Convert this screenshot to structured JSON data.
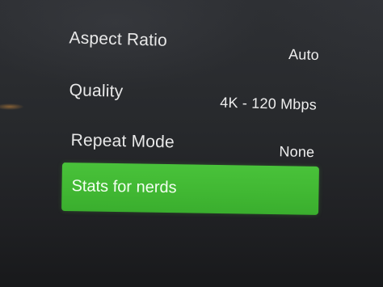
{
  "menu": {
    "items": [
      {
        "label": "Aspect Ratio",
        "value": "Auto"
      },
      {
        "label": "Quality",
        "value": "4K - 120 Mbps"
      },
      {
        "label": "Repeat Mode",
        "value": "None"
      },
      {
        "label": "Stats for nerds",
        "selected": true
      }
    ]
  },
  "colors": {
    "background": "#27292c",
    "selected_highlight": "#43bb35",
    "text": "#e8e8e8"
  }
}
